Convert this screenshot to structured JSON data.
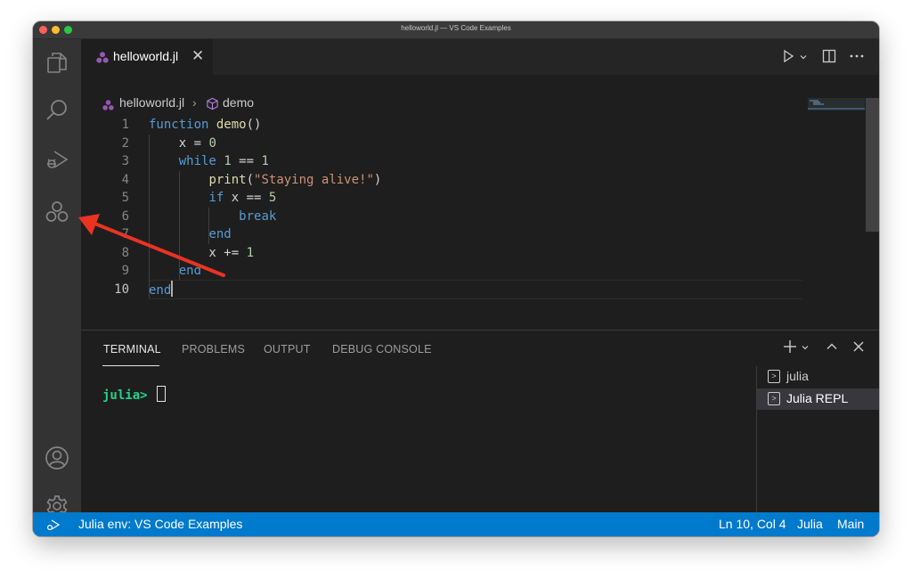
{
  "window": {
    "title": "helloworld.jl — VS Code Examples"
  },
  "activity_bar": {
    "items": [
      {
        "name": "explorer",
        "icon": "files-icon"
      },
      {
        "name": "search",
        "icon": "search-icon"
      },
      {
        "name": "run-and-debug",
        "icon": "run-debug-icon"
      },
      {
        "name": "julia",
        "icon": "julia-circles-icon"
      }
    ],
    "bottom": [
      {
        "name": "accounts",
        "icon": "account-icon"
      },
      {
        "name": "manage",
        "icon": "gear-icon"
      }
    ]
  },
  "editor": {
    "tab": {
      "label": "helloworld.jl",
      "icon": "julia-file-icon",
      "close": "✕"
    },
    "breadcrumb": {
      "file": "helloworld.jl",
      "separator": "›",
      "symbol": "demo",
      "symbol_icon": "cube-icon"
    },
    "lines": [
      {
        "n": "1",
        "tokens": [
          {
            "t": "function",
            "c": "kw"
          },
          {
            "t": " ",
            "c": "pl"
          },
          {
            "t": "demo",
            "c": "fn"
          },
          {
            "t": "()",
            "c": "pl"
          }
        ]
      },
      {
        "n": "2",
        "tokens": [
          {
            "t": "    x = ",
            "c": "pl"
          },
          {
            "t": "0",
            "c": "num"
          }
        ]
      },
      {
        "n": "3",
        "tokens": [
          {
            "t": "    ",
            "c": "pl"
          },
          {
            "t": "while",
            "c": "kw"
          },
          {
            "t": " ",
            "c": "pl"
          },
          {
            "t": "1",
            "c": "num"
          },
          {
            "t": " == ",
            "c": "pl"
          },
          {
            "t": "1",
            "c": "num"
          }
        ]
      },
      {
        "n": "4",
        "tokens": [
          {
            "t": "        ",
            "c": "pl"
          },
          {
            "t": "print",
            "c": "fn"
          },
          {
            "t": "(",
            "c": "pl"
          },
          {
            "t": "\"Staying alive!\"",
            "c": "str"
          },
          {
            "t": ")",
            "c": "pl"
          }
        ]
      },
      {
        "n": "5",
        "tokens": [
          {
            "t": "        ",
            "c": "pl"
          },
          {
            "t": "if",
            "c": "kw"
          },
          {
            "t": " x == ",
            "c": "pl"
          },
          {
            "t": "5",
            "c": "num"
          }
        ]
      },
      {
        "n": "6",
        "tokens": [
          {
            "t": "            ",
            "c": "pl"
          },
          {
            "t": "break",
            "c": "kw"
          }
        ]
      },
      {
        "n": "7",
        "tokens": [
          {
            "t": "        ",
            "c": "pl"
          },
          {
            "t": "end",
            "c": "kw"
          }
        ]
      },
      {
        "n": "8",
        "tokens": [
          {
            "t": "        x += ",
            "c": "pl"
          },
          {
            "t": "1",
            "c": "num"
          }
        ]
      },
      {
        "n": "9",
        "tokens": [
          {
            "t": "    ",
            "c": "pl"
          },
          {
            "t": "end",
            "c": "kw"
          }
        ]
      },
      {
        "n": "10",
        "tokens": [
          {
            "t": "end",
            "c": "kw"
          }
        ]
      }
    ],
    "active_line": "10"
  },
  "panel": {
    "tabs": [
      "TERMINAL",
      "PROBLEMS",
      "OUTPUT",
      "DEBUG CONSOLE"
    ],
    "active_tab": "TERMINAL",
    "terminal": {
      "prompt": "julia>"
    },
    "terminals": [
      {
        "name": "julia",
        "selected": false
      },
      {
        "name": "Julia REPL",
        "selected": true
      }
    ]
  },
  "status_bar": {
    "left": {
      "env": "Julia env: VS Code Examples"
    },
    "right": {
      "position": "Ln 10, Col 4",
      "language": "Julia",
      "branch": "Main"
    }
  },
  "colors": {
    "accent": "#007acc",
    "annotation_arrow": "#ea3323",
    "julia_purple": "#9558b2"
  }
}
